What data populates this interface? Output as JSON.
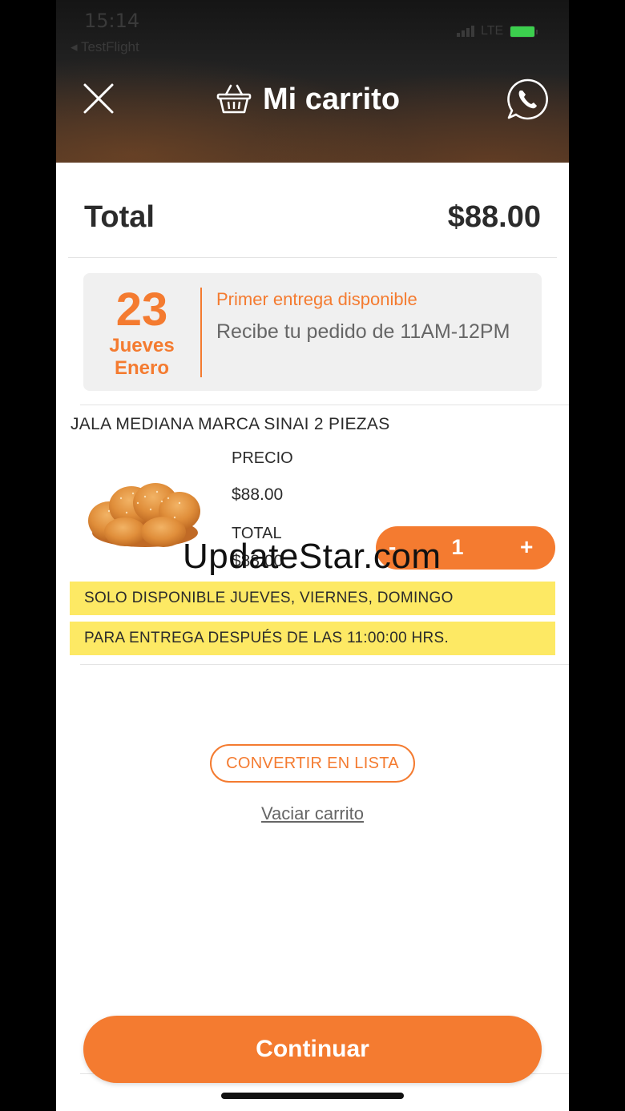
{
  "status_bar": {
    "time": "15:14",
    "back_app": "◂ TestFlight",
    "network": "LTE"
  },
  "header": {
    "title": "Mi carrito",
    "close_icon": "close-icon",
    "basket_icon": "basket-icon",
    "whatsapp_icon": "whatsapp-icon"
  },
  "summary": {
    "total_label": "Total",
    "total_value": "$88.00"
  },
  "delivery": {
    "day": "23",
    "weekday": "Jueves",
    "month": "Enero",
    "heading": "Primer entrega disponible",
    "body": "Recibe tu pedido de 11AM-12PM"
  },
  "product": {
    "name": "JALA MEDIANA MARCA SINAI 2 PIEZAS",
    "price_label": "PRECIO",
    "price": "$88.00",
    "total_label": "TOTAL",
    "total": "$88.00",
    "quantity": "1",
    "minus": "-",
    "plus": "+",
    "notices": [
      "SOLO DISPONIBLE JUEVES, VIERNES, DOMINGO",
      "PARA ENTREGA DESPUÉS DE LAS 11:00:00 HRS."
    ]
  },
  "watermark": "UpdateStar.com",
  "actions": {
    "convert_label": "CONVERTIR EN LISTA",
    "clear_label": "Vaciar carrito",
    "continue_label": "Continuar"
  },
  "colors": {
    "accent": "#f47b30",
    "notice_bg": "#fde964",
    "card_bg": "#f0f0f0",
    "battery": "#3ccf4e"
  }
}
